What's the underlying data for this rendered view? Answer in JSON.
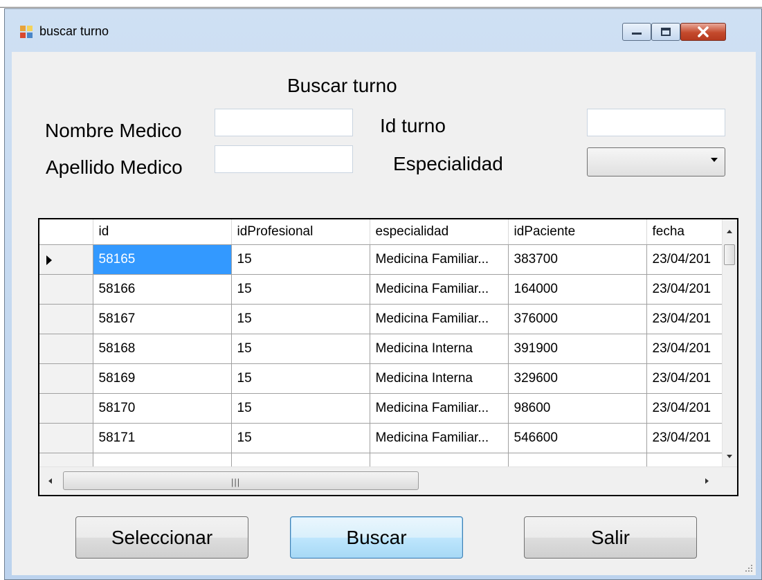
{
  "window": {
    "title": "buscar turno"
  },
  "form": {
    "heading": "Buscar turno",
    "nombre_medico_label": "Nombre Medico",
    "nombre_medico_value": "",
    "apellido_medico_label": "Apellido Medico",
    "apellido_medico_value": "",
    "id_turno_label": "Id turno",
    "id_turno_value": "",
    "especialidad_label": "Especialidad",
    "especialidad_value": ""
  },
  "grid": {
    "columns": [
      "id",
      "idProfesional",
      "especialidad",
      "idPaciente",
      "fecha"
    ],
    "rows": [
      [
        "58165",
        "15",
        "Medicina Familiar...",
        "383700",
        "23/04/201"
      ],
      [
        "58166",
        "15",
        "Medicina Familiar...",
        "164000",
        "23/04/201"
      ],
      [
        "58167",
        "15",
        "Medicina Familiar...",
        "376000",
        "23/04/201"
      ],
      [
        "58168",
        "15",
        "Medicina Interna",
        "391900",
        "23/04/201"
      ],
      [
        "58169",
        "15",
        "Medicina Interna",
        "329600",
        "23/04/201"
      ],
      [
        "58170",
        "15",
        "Medicina Familiar...",
        "98600",
        "23/04/201"
      ],
      [
        "58171",
        "15",
        "Medicina Familiar...",
        "546600",
        "23/04/201"
      ]
    ],
    "selected_row": 0
  },
  "buttons": {
    "seleccionar": "Seleccionar",
    "buscar": "Buscar",
    "salir": "Salir"
  }
}
